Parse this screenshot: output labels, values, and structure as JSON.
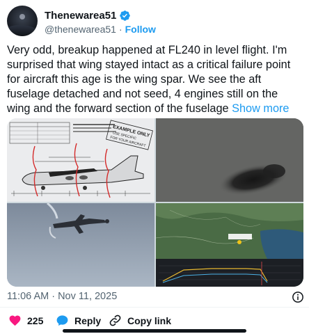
{
  "author": {
    "display_name": "Thenewarea51",
    "handle": "@thenewarea51",
    "separator": "·",
    "follow_label": "Follow"
  },
  "tweet": {
    "text": "Very odd, breakup happened at FL240 in level flight. I'm surprised that wing stayed intact as a critical failure point for aircraft this age is the wing spar. We see the aft fuselage detached and not seed, 4 engines still on the wing and the forward section of the fuselage",
    "show_more_label": "Show more"
  },
  "media": {
    "diagram_stamp_line1": "EXAMPLE ONLY",
    "diagram_stamp_line2": "USE SPECIFIC",
    "diagram_stamp_line3": "FOR YOUR AIRCRAFT"
  },
  "meta": {
    "timestamp": "11:06 AM · Nov 11, 2025"
  },
  "actions": {
    "like_count": "225",
    "reply_label": "Reply",
    "copy_link_label": "Copy link"
  },
  "colors": {
    "accent": "#1d9bf0",
    "like": "#f91880",
    "text": "#0f1419",
    "secondary_text": "#536471"
  }
}
